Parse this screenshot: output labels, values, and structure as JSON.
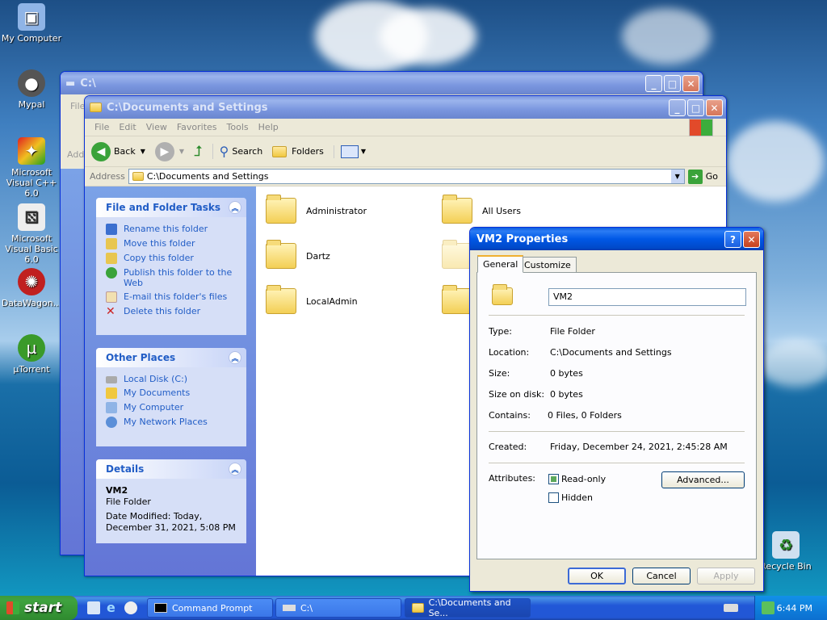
{
  "desktop": {
    "icons": [
      {
        "label": "My Computer"
      },
      {
        "label": "Mypal"
      },
      {
        "label": "Microsoft Visual C++ 6.0"
      },
      {
        "label": "Microsoft Visual Basic 6.0"
      },
      {
        "label": "DataWagon..."
      },
      {
        "label": "µTorrent"
      },
      {
        "label": "Recycle Bin"
      }
    ]
  },
  "back_window": {
    "title": "C:\\",
    "menu_first": "File",
    "addr_label": "Addr"
  },
  "explorer": {
    "title": "C:\\Documents and Settings",
    "menu": [
      "File",
      "Edit",
      "View",
      "Favorites",
      "Tools",
      "Help"
    ],
    "toolbar": {
      "back": "Back",
      "search": "Search",
      "folders": "Folders"
    },
    "address_label": "Address",
    "address_value": "C:\\Documents and Settings",
    "go": "Go",
    "tasks": {
      "title": "File and Folder Tasks",
      "items": [
        "Rename this folder",
        "Move this folder",
        "Copy this folder",
        "Publish this folder to the Web",
        "E-mail this folder's files",
        "Delete this folder"
      ]
    },
    "other": {
      "title": "Other Places",
      "items": [
        "Local Disk (C:)",
        "My Documents",
        "My Computer",
        "My Network Places"
      ]
    },
    "details": {
      "title": "Details",
      "name": "VM2",
      "type": "File Folder",
      "modified": "Date Modified: Today, December 31, 2021, 5:08 PM"
    },
    "folders": [
      "Administrator",
      "All Users",
      "Dartz",
      "LocalAdmin"
    ]
  },
  "dialog": {
    "title": "VM2 Properties",
    "tabs": [
      "General",
      "Customize"
    ],
    "name_value": "VM2",
    "labels": {
      "type": "Type:",
      "location": "Location:",
      "size": "Size:",
      "size_on_disk": "Size on disk:",
      "contains": "Contains:",
      "created": "Created:",
      "attributes": "Attributes:"
    },
    "values": {
      "type": "File Folder",
      "location": "C:\\Documents and Settings",
      "size": "0 bytes",
      "size_on_disk": "0 bytes",
      "contains": "0 Files, 0 Folders",
      "created": "Friday, December 24, 2021, 2:45:28 AM"
    },
    "readonly": "Read-only",
    "hidden": "Hidden",
    "advanced": "Advanced...",
    "ok": "OK",
    "cancel": "Cancel",
    "apply": "Apply"
  },
  "taskbar": {
    "start": "start",
    "tasks": [
      "Command Prompt",
      "C:\\",
      "C:\\Documents and Se..."
    ],
    "clock": "6:44 PM"
  }
}
